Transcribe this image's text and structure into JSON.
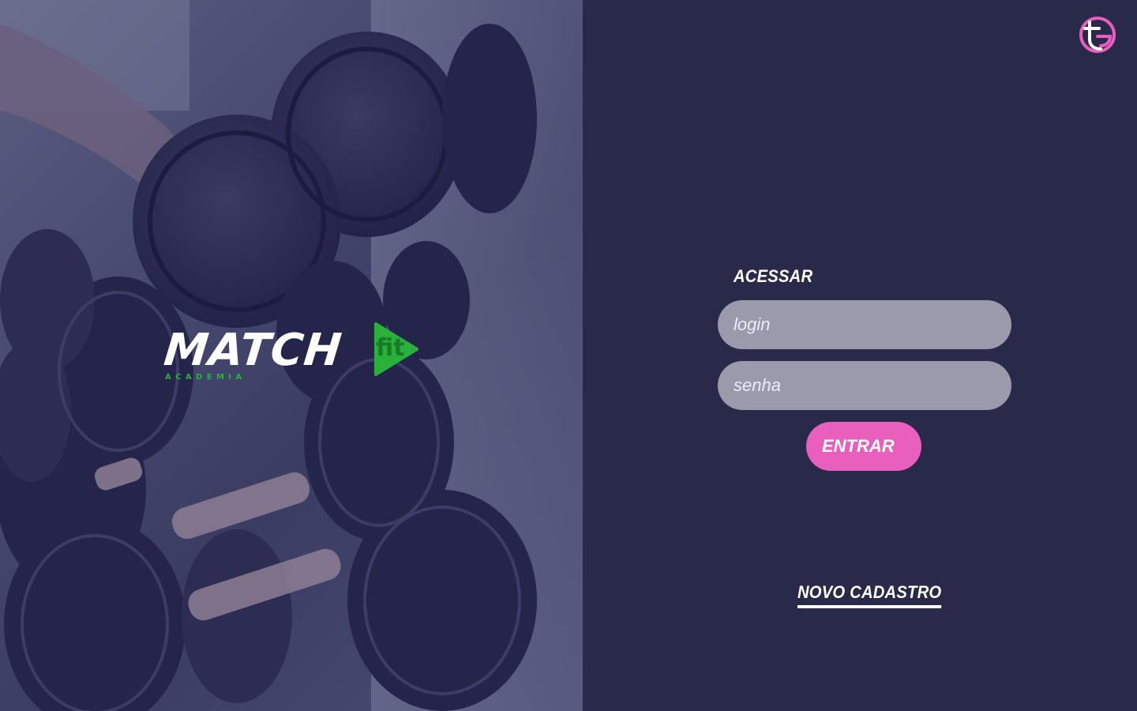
{
  "brand": {
    "logo_word": "MATCH",
    "logo_badge": "fit",
    "logo_sub": "ACADEMIA",
    "accent_green": "#28b23a",
    "corner_badge_icon": "brand-monogram-icon",
    "corner_badge_color": "#e95fbd"
  },
  "panel": {
    "background": "#29294a"
  },
  "login": {
    "title": "ACESSAR",
    "login_placeholder": "login",
    "login_value": "",
    "password_placeholder": "senha",
    "password_value": "",
    "submit_label": "ENTRAR",
    "submit_color": "#e95fbd"
  },
  "register": {
    "label": "NOVO CADASTRO"
  }
}
